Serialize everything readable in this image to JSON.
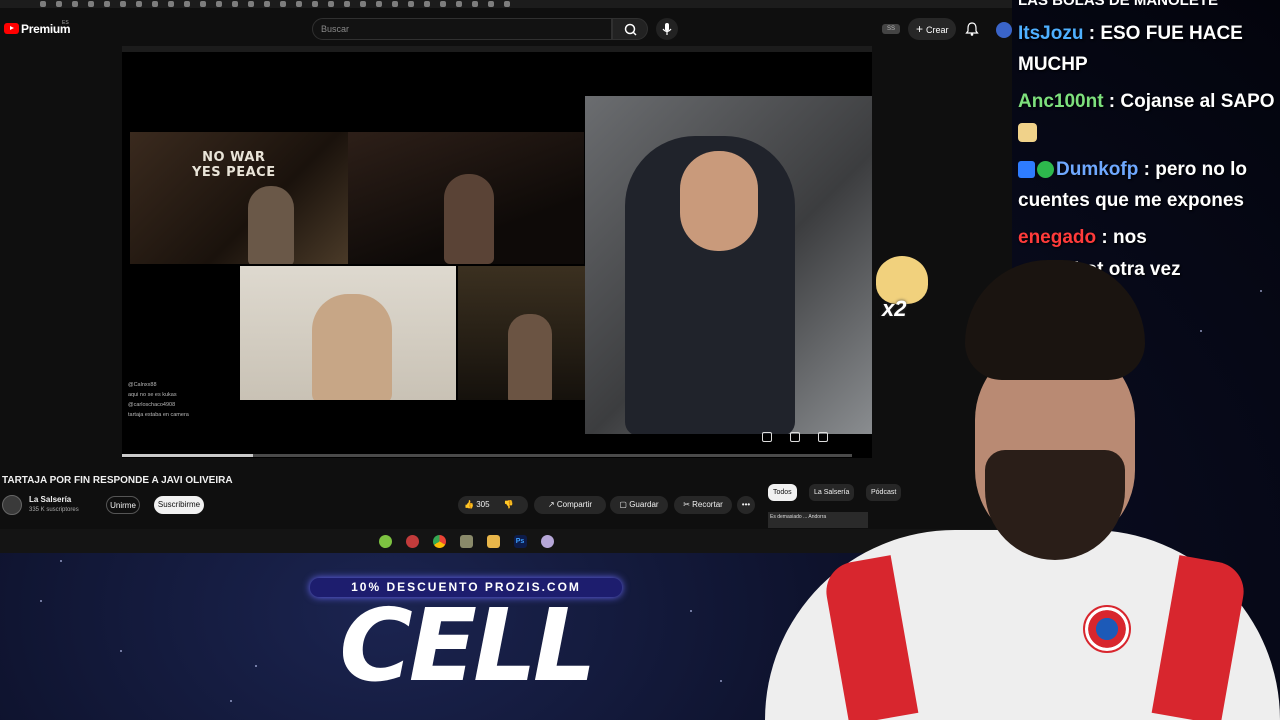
{
  "youtube": {
    "brand": "Premium",
    "brand_sup": "ES",
    "search_placeholder": "Buscar",
    "ss_badge": "SS",
    "create_label": "Crear",
    "video": {
      "title": "TARTAJA POR FIN RESPONDE A JAVI OLIVEIRA",
      "progress": 0.18,
      "overlay_sign": [
        "NO WAR",
        "YES PEACE"
      ],
      "mini_chat": [
        "@Calnxx88",
        "aqui no se es kukas",
        "@carloschaco4908",
        "tartaja estaba en camera"
      ]
    },
    "channel": {
      "name": "La Salsería",
      "subs": "335 K suscriptores",
      "join_label": "Unirme",
      "subscribe_label": "Suscribirme"
    },
    "actions": {
      "likes": "305",
      "share": "Compartir",
      "save": "Guardar",
      "clip": "Recortar",
      "more": "•••"
    },
    "chips": [
      "Todos",
      "La Salsería",
      "Pódcast"
    ],
    "rec_thumb_text": "Es demasiado ... Andorra"
  },
  "emote": {
    "count": "x2"
  },
  "promo": {
    "banner": "10% DESCUENTO PROZIS.COM",
    "big_text": "CELL"
  },
  "chat": {
    "prev_line": "LAS BOLAS DE MANOLETE",
    "messages": [
      {
        "user": "ItsJozu",
        "user_color": "#4fb0ff",
        "text": " : ESO FUE HACE MUCHP"
      },
      {
        "user": "Anc100nt",
        "user_color": "#7de07d",
        "text": " : Cojanse al SAPO"
      },
      {
        "user": "Dumkofp",
        "user_color": "#6fa8ff",
        "text": " : pero no lo cuentes que me expones"
      },
      {
        "user": "enegado",
        "user_color": "#ff3b3b",
        "text": " : nos"
      },
      {
        "user": "",
        "user_color": "#ffffff",
        "text": "oy un bot otra vez"
      }
    ]
  },
  "colors": {
    "yt_bg": "#0f0f0f",
    "accent_red": "#ff0000",
    "promo_blue": "#1d1d6e",
    "jersey_red": "#d8262e"
  }
}
